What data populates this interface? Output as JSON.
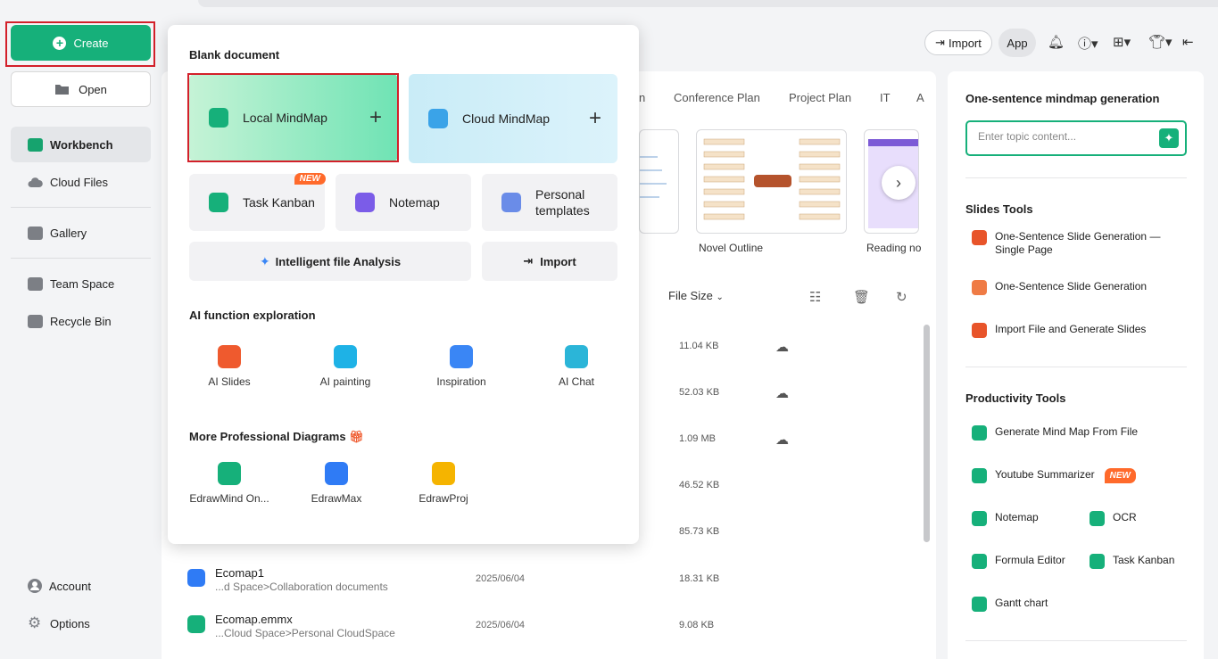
{
  "sidebar": {
    "create_label": "Create",
    "open_label": "Open",
    "items": [
      {
        "label": "Workbench",
        "icon": "workbench-icon"
      },
      {
        "label": "Cloud Files",
        "icon": "cloud-icon"
      },
      {
        "label": "Gallery",
        "icon": "gallery-icon"
      },
      {
        "label": "Team Space",
        "icon": "team-space-icon"
      },
      {
        "label": "Recycle Bin",
        "icon": "recycle-bin-icon"
      }
    ],
    "bottom": [
      {
        "label": "Account",
        "icon": "account-icon"
      },
      {
        "label": "Options",
        "icon": "gear-icon"
      }
    ]
  },
  "header": {
    "import_label": "Import",
    "app_label": "App"
  },
  "templates": {
    "tabs": [
      "n",
      "Conference Plan",
      "Project Plan",
      "IT",
      "A"
    ],
    "cards": [
      {
        "label": "Novel Outline"
      },
      {
        "label": "Reading no"
      }
    ]
  },
  "file_list": {
    "size_header": "File Size",
    "sizes": [
      "11.04 KB",
      "52.03 KB",
      "1.09 MB",
      "46.52 KB",
      "85.73 KB"
    ],
    "files": [
      {
        "name": "Ecomap1",
        "path": "...d Space>Collaboration documents",
        "date": "2025/06/04",
        "size": "18.31 KB"
      },
      {
        "name": "Ecomap.emmx",
        "path": "...Cloud Space>Personal CloudSpace",
        "date": "2025/06/04",
        "size": "9.08 KB"
      }
    ]
  },
  "menu": {
    "blank_title": "Blank document",
    "local_mindmap": "Local MindMap",
    "cloud_mindmap": "Cloud MindMap",
    "task_kanban": "Task Kanban",
    "new_badge": "NEW",
    "notemap": "Notemap",
    "personal_templates": "Personal templates",
    "intelligent_analysis": "Intelligent file Analysis",
    "import": "Import",
    "ai_title": "AI function exploration",
    "ai_items": [
      "AI Slides",
      "AI painting",
      "Inspiration",
      "AI Chat"
    ],
    "pro_title": "More Professional Diagrams",
    "pro_items": [
      "EdrawMind On...",
      "EdrawMax",
      "EdrawProj"
    ]
  },
  "right_panel": {
    "gen_title": "One-sentence mindmap generation",
    "gen_placeholder": "Enter topic content...",
    "slides_title": "Slides Tools",
    "slides_items": [
      "One-Sentence Slide Generation — Single Page",
      "One-Sentence Slide Generation",
      "Import File and Generate Slides"
    ],
    "prod_title": "Productivity Tools",
    "prod_items": [
      "Generate Mind Map From File",
      "Youtube Summarizer",
      "Notemap",
      "OCR",
      "Formula Editor",
      "Task Kanban",
      "Gantt chart"
    ],
    "new_badge": "NEW"
  },
  "colors": {
    "accent": "#16b07a",
    "highlight": "#d3202a",
    "badge": "#ff6a2b"
  }
}
